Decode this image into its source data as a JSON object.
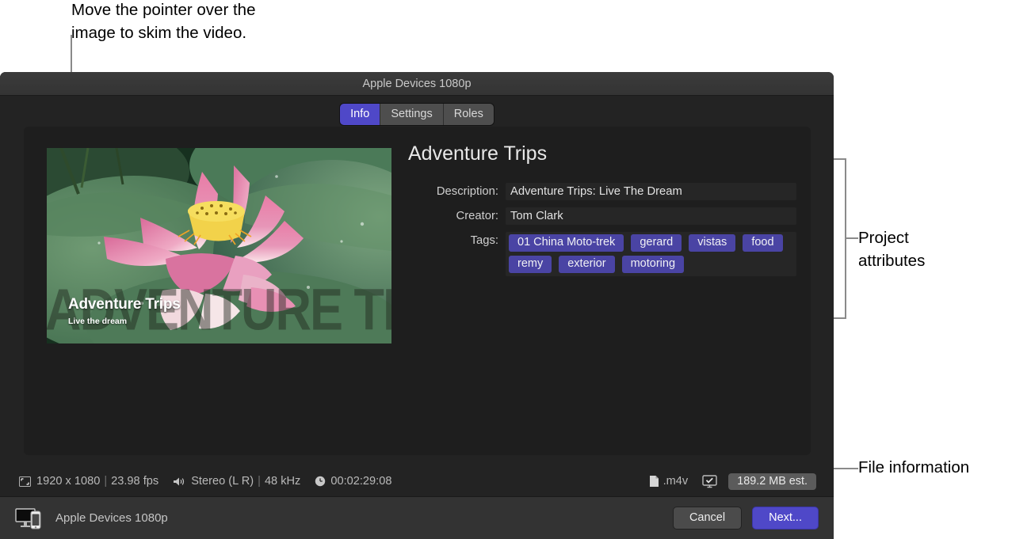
{
  "annotations": {
    "top_callout": "Move the pointer over the\nimage to skim the video.",
    "project_attributes": "Project\nattributes",
    "file_information": "File information"
  },
  "window": {
    "title": "Apple Devices 1080p"
  },
  "tabs": [
    {
      "label": "Info",
      "active": true
    },
    {
      "label": "Settings",
      "active": false
    },
    {
      "label": "Roles",
      "active": false
    }
  ],
  "thumbnail": {
    "overlay_title": "Adventure Trips",
    "overlay_subtitle": "Live the dream",
    "background_text": "ADVENTURE TRIPS",
    "icon": "video-thumbnail"
  },
  "attributes": {
    "project_title": "Adventure Trips",
    "description_label": "Description:",
    "description_value": "Adventure Trips: Live The Dream",
    "creator_label": "Creator:",
    "creator_value": "Tom Clark",
    "tags_label": "Tags:",
    "tags": [
      "01 China Moto-trek",
      "gerard",
      "vistas",
      "food",
      "remy",
      "exterior",
      "motoring"
    ]
  },
  "statusbar": {
    "resolution": "1920 x 1080",
    "separator": "|",
    "fps": "23.98 fps",
    "audio": "Stereo (L R)",
    "sample_rate": "48 kHz",
    "duration": "00:02:29:08",
    "file_extension": ".m4v",
    "size_estimate": "189.2 MB est.",
    "icons": {
      "frame": "frame-icon",
      "speaker": "speaker-icon",
      "clock": "clock-icon",
      "document": "document-icon",
      "display_check": "display-check-icon"
    }
  },
  "footer": {
    "device_label": "Apple Devices 1080p",
    "device_icon": "computer-and-phone-icon",
    "cancel_label": "Cancel",
    "next_label": "Next..."
  },
  "colors": {
    "accent": "#4f48c8",
    "tag": "#4a44a4",
    "window_bg": "#232323",
    "panel_bg": "#1e1e1e",
    "footer_bg": "#333333"
  }
}
